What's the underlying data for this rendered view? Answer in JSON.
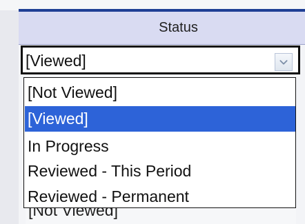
{
  "status_column": {
    "header": "Status",
    "selected_value": "[Viewed]",
    "options": [
      "[Not Viewed]",
      "[Viewed]",
      "In Progress",
      "Reviewed - This Period",
      "Reviewed - Permanent"
    ],
    "selected_index": 1,
    "next_row_value": "[Not Viewed]"
  },
  "colors": {
    "header_background": "#d9dbf2",
    "selected_option": "#2d63d8",
    "header_rule": "#1f3f95"
  },
  "icons": {
    "dropdown": "chevron-down-icon"
  }
}
